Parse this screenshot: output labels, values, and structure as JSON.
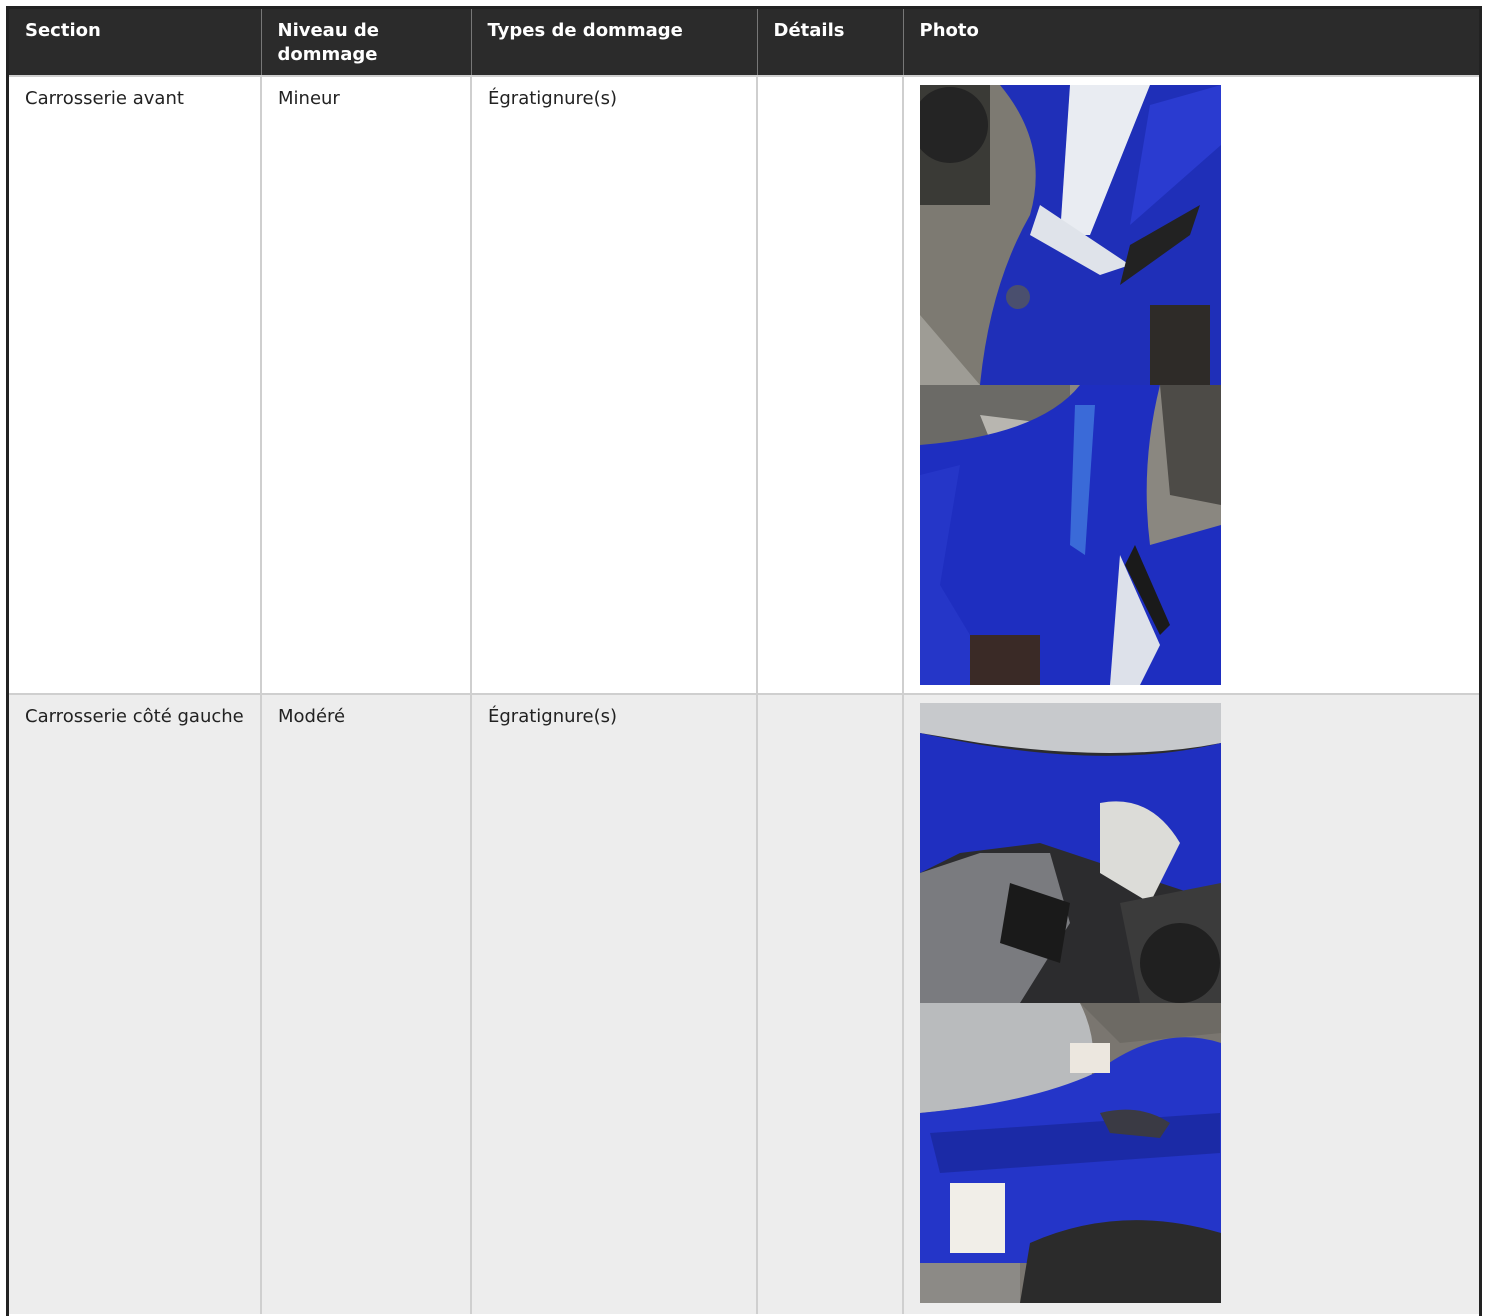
{
  "headers": {
    "section": "Section",
    "level": "Niveau de dommage",
    "types": "Types de dommage",
    "details": "Détails",
    "photo": "Photo"
  },
  "rows": [
    {
      "section": "Carrosserie avant",
      "level": "Mineur",
      "types": "Égratignure(s)",
      "details": "",
      "photos": [
        "front-fairing-photo",
        "front-fairing-closeup-photo"
      ]
    },
    {
      "section": "Carrosserie côté gauche",
      "level": "Modéré",
      "types": "Égratignure(s)",
      "details": "",
      "photos": [
        "left-side-panel-photo",
        "left-side-rear-fender-photo"
      ]
    }
  ]
}
